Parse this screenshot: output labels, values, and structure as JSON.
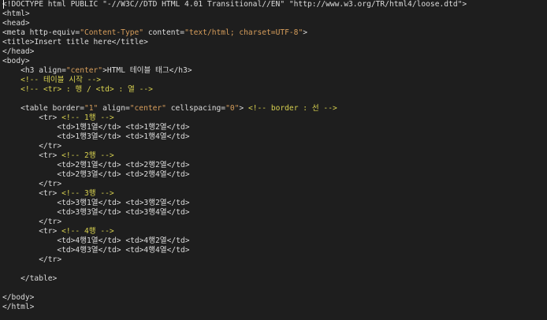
{
  "colors": {
    "background": "#1e1e1e",
    "text": "#dcdcdc",
    "string": "#d69d5b",
    "comment": "#d7d04f"
  },
  "lines": [
    [
      {
        "t": "tag",
        "v": "<!DOCTYPE html PUBLIC \"-//W3C//DTD HTML 4.01 Transitional//EN\" \"http://www.w3.org/TR/html4/loose.dtd\">"
      }
    ],
    [
      {
        "t": "tag",
        "v": "<html>"
      }
    ],
    [
      {
        "t": "tag",
        "v": "<head>"
      }
    ],
    [
      {
        "t": "tag",
        "v": "<meta http-equiv="
      },
      {
        "t": "str",
        "v": "\"Content-Type\""
      },
      {
        "t": "tag",
        "v": " content="
      },
      {
        "t": "str",
        "v": "\"text/html; charset=UTF-8\""
      },
      {
        "t": "tag",
        "v": ">"
      }
    ],
    [
      {
        "t": "tag",
        "v": "<title>"
      },
      {
        "t": "text",
        "v": "Insert title here"
      },
      {
        "t": "tag",
        "v": "</title>"
      }
    ],
    [
      {
        "t": "tag",
        "v": "</head>"
      }
    ],
    [
      {
        "t": "tag",
        "v": "<body>"
      }
    ],
    [
      {
        "t": "text",
        "v": "    "
      },
      {
        "t": "tag",
        "v": "<h3 align="
      },
      {
        "t": "str",
        "v": "\"center\""
      },
      {
        "t": "tag",
        "v": ">"
      },
      {
        "t": "text",
        "v": "HTML 테이블 태그"
      },
      {
        "t": "tag",
        "v": "</h3>"
      }
    ],
    [
      {
        "t": "text",
        "v": "    "
      },
      {
        "t": "comment",
        "v": "<!-- 테이블 시작 -->"
      }
    ],
    [
      {
        "t": "text",
        "v": "    "
      },
      {
        "t": "comment",
        "v": "<!-- <tr> : 행 / <td> : 열 -->"
      }
    ],
    [
      {
        "t": "text",
        "v": ""
      }
    ],
    [
      {
        "t": "text",
        "v": "    "
      },
      {
        "t": "tag",
        "v": "<table border="
      },
      {
        "t": "str",
        "v": "\"1\""
      },
      {
        "t": "tag",
        "v": " align="
      },
      {
        "t": "str",
        "v": "\"center\""
      },
      {
        "t": "tag",
        "v": " cellspacing="
      },
      {
        "t": "str",
        "v": "\"0\""
      },
      {
        "t": "tag",
        "v": ">"
      },
      {
        "t": "text",
        "v": " "
      },
      {
        "t": "comment",
        "v": "<!-- border : 선 -->"
      }
    ],
    [
      {
        "t": "text",
        "v": "        "
      },
      {
        "t": "tag",
        "v": "<tr>"
      },
      {
        "t": "text",
        "v": " "
      },
      {
        "t": "comment",
        "v": "<!-- 1행 -->"
      }
    ],
    [
      {
        "t": "text",
        "v": "            "
      },
      {
        "t": "tag",
        "v": "<td>"
      },
      {
        "t": "text",
        "v": "1행1열"
      },
      {
        "t": "tag",
        "v": "</td>"
      },
      {
        "t": "text",
        "v": " "
      },
      {
        "t": "tag",
        "v": "<td>"
      },
      {
        "t": "text",
        "v": "1행2열"
      },
      {
        "t": "tag",
        "v": "</td>"
      }
    ],
    [
      {
        "t": "text",
        "v": "            "
      },
      {
        "t": "tag",
        "v": "<td>"
      },
      {
        "t": "text",
        "v": "1행3열"
      },
      {
        "t": "tag",
        "v": "</td>"
      },
      {
        "t": "text",
        "v": " "
      },
      {
        "t": "tag",
        "v": "<td>"
      },
      {
        "t": "text",
        "v": "1행4열"
      },
      {
        "t": "tag",
        "v": "</td>"
      }
    ],
    [
      {
        "t": "text",
        "v": "        "
      },
      {
        "t": "tag",
        "v": "</tr>"
      }
    ],
    [
      {
        "t": "text",
        "v": "        "
      },
      {
        "t": "tag",
        "v": "<tr>"
      },
      {
        "t": "text",
        "v": " "
      },
      {
        "t": "comment",
        "v": "<!-- 2행 -->"
      }
    ],
    [
      {
        "t": "text",
        "v": "            "
      },
      {
        "t": "tag",
        "v": "<td>"
      },
      {
        "t": "text",
        "v": "2행1열"
      },
      {
        "t": "tag",
        "v": "</td>"
      },
      {
        "t": "text",
        "v": " "
      },
      {
        "t": "tag",
        "v": "<td>"
      },
      {
        "t": "text",
        "v": "2행2열"
      },
      {
        "t": "tag",
        "v": "</td>"
      }
    ],
    [
      {
        "t": "text",
        "v": "            "
      },
      {
        "t": "tag",
        "v": "<td>"
      },
      {
        "t": "text",
        "v": "2행3열"
      },
      {
        "t": "tag",
        "v": "</td>"
      },
      {
        "t": "text",
        "v": " "
      },
      {
        "t": "tag",
        "v": "<td>"
      },
      {
        "t": "text",
        "v": "2행4열"
      },
      {
        "t": "tag",
        "v": "</td>"
      }
    ],
    [
      {
        "t": "text",
        "v": "        "
      },
      {
        "t": "tag",
        "v": "</tr>"
      }
    ],
    [
      {
        "t": "text",
        "v": "        "
      },
      {
        "t": "tag",
        "v": "<tr>"
      },
      {
        "t": "text",
        "v": " "
      },
      {
        "t": "comment",
        "v": "<!-- 3행 -->"
      }
    ],
    [
      {
        "t": "text",
        "v": "            "
      },
      {
        "t": "tag",
        "v": "<td>"
      },
      {
        "t": "text",
        "v": "3행1열"
      },
      {
        "t": "tag",
        "v": "</td>"
      },
      {
        "t": "text",
        "v": " "
      },
      {
        "t": "tag",
        "v": "<td>"
      },
      {
        "t": "text",
        "v": "3행2열"
      },
      {
        "t": "tag",
        "v": "</td>"
      }
    ],
    [
      {
        "t": "text",
        "v": "            "
      },
      {
        "t": "tag",
        "v": "<td>"
      },
      {
        "t": "text",
        "v": "3행3열"
      },
      {
        "t": "tag",
        "v": "</td>"
      },
      {
        "t": "text",
        "v": " "
      },
      {
        "t": "tag",
        "v": "<td>"
      },
      {
        "t": "text",
        "v": "3행4열"
      },
      {
        "t": "tag",
        "v": "</td>"
      }
    ],
    [
      {
        "t": "text",
        "v": "        "
      },
      {
        "t": "tag",
        "v": "</tr>"
      }
    ],
    [
      {
        "t": "text",
        "v": "        "
      },
      {
        "t": "tag",
        "v": "<tr>"
      },
      {
        "t": "text",
        "v": " "
      },
      {
        "t": "comment",
        "v": "<!-- 4행 -->"
      }
    ],
    [
      {
        "t": "text",
        "v": "            "
      },
      {
        "t": "tag",
        "v": "<td>"
      },
      {
        "t": "text",
        "v": "4행1열"
      },
      {
        "t": "tag",
        "v": "</td>"
      },
      {
        "t": "text",
        "v": " "
      },
      {
        "t": "tag",
        "v": "<td>"
      },
      {
        "t": "text",
        "v": "4행2열"
      },
      {
        "t": "tag",
        "v": "</td>"
      }
    ],
    [
      {
        "t": "text",
        "v": "            "
      },
      {
        "t": "tag",
        "v": "<td>"
      },
      {
        "t": "text",
        "v": "4행3열"
      },
      {
        "t": "tag",
        "v": "</td>"
      },
      {
        "t": "text",
        "v": " "
      },
      {
        "t": "tag",
        "v": "<td>"
      },
      {
        "t": "text",
        "v": "4행4열"
      },
      {
        "t": "tag",
        "v": "</td>"
      }
    ],
    [
      {
        "t": "text",
        "v": "        "
      },
      {
        "t": "tag",
        "v": "</tr>"
      }
    ],
    [
      {
        "t": "text",
        "v": ""
      }
    ],
    [
      {
        "t": "text",
        "v": "    "
      },
      {
        "t": "tag",
        "v": "</table>"
      }
    ],
    [
      {
        "t": "text",
        "v": ""
      }
    ],
    [
      {
        "t": "tag",
        "v": "</body>"
      }
    ],
    [
      {
        "t": "tag",
        "v": "</html>"
      }
    ]
  ]
}
